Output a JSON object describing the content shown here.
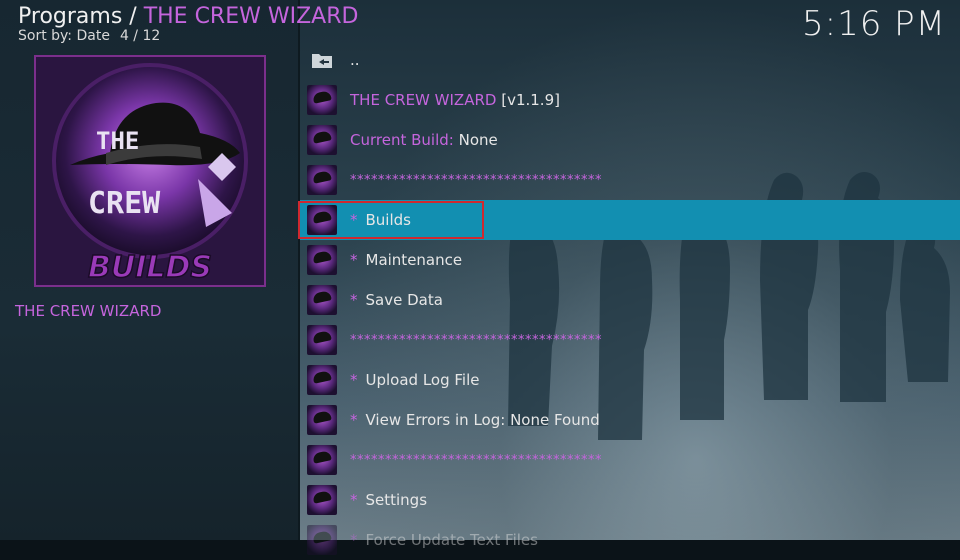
{
  "header": {
    "section": "Programs / ",
    "addon": "THE CREW WIZARD",
    "sort_label": "Sort by: Date",
    "position": "4 / 12",
    "clock": "5:16 PM"
  },
  "poster": {
    "logo_text_top": "THE",
    "logo_text_mid": "CREW",
    "logo_text_bottom": "BUILDS"
  },
  "left_panel": {
    "addon_name": "THE CREW WIZARD"
  },
  "list": {
    "parent": "..",
    "title_name": "THE CREW WIZARD",
    "title_version": "[v1.1.9]",
    "build_label": "Current Build:",
    "build_value": "None",
    "separator": "************************************",
    "asterisk": "*",
    "builds": "Builds",
    "maintenance": "Maintenance",
    "save_data": "Save Data",
    "upload_log": "Upload Log File",
    "view_errors": "View Errors in Log: None Found",
    "settings": "Settings",
    "force_update": "Force Update Text Files"
  },
  "colors": {
    "accent_purple": "#c565dd",
    "selection_blue": "#128fb1",
    "highlight_red": "#d0282f"
  }
}
